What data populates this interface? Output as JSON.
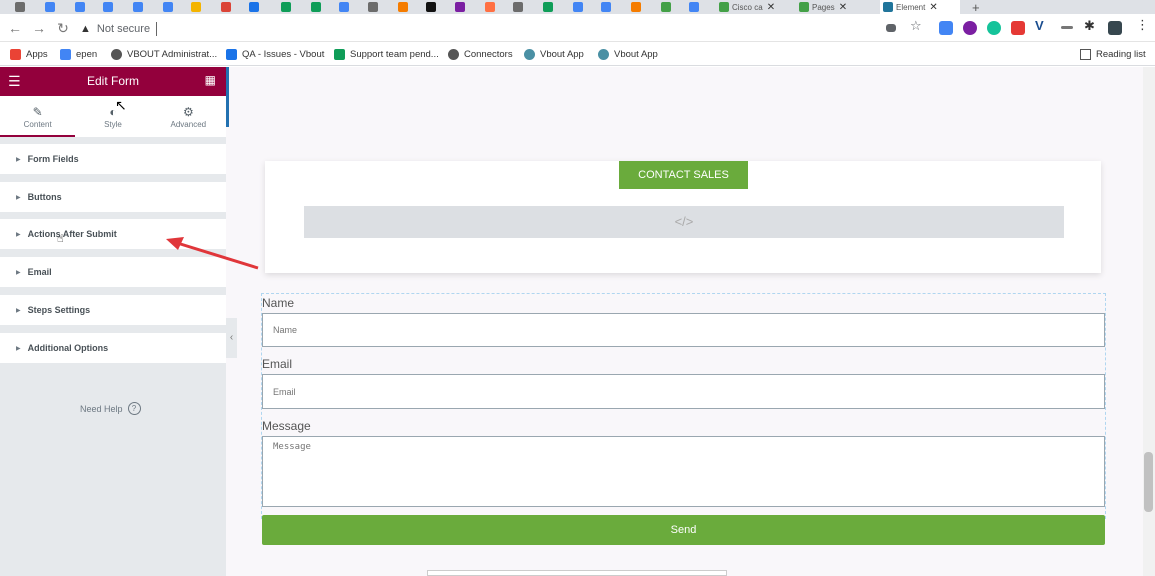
{
  "browser": {
    "tabs": [
      {
        "label": "",
        "color": "#6c6c6c"
      },
      {
        "label": "",
        "color": "#4285f4"
      },
      {
        "label": "",
        "color": "#4285f4"
      },
      {
        "label": "",
        "color": "#4285f4"
      },
      {
        "label": "",
        "color": "#4285f4"
      },
      {
        "label": "",
        "color": "#4285f4"
      },
      {
        "label": "",
        "color": "#f4b400"
      },
      {
        "label": "",
        "color": "#db4437"
      },
      {
        "label": "",
        "color": "#1a73e8"
      },
      {
        "label": "",
        "color": "#0f9d58"
      },
      {
        "label": "",
        "color": "#0f9d58"
      },
      {
        "label": "",
        "color": "#4285f4"
      },
      {
        "label": "",
        "color": "#6c6c6c"
      },
      {
        "label": "",
        "color": "#f57c00"
      },
      {
        "label": "",
        "color": "#111111"
      },
      {
        "label": "",
        "color": "#7b1fa2"
      },
      {
        "label": "",
        "color": "#ff7043"
      },
      {
        "label": "",
        "color": "#6c6c6c"
      },
      {
        "label": "",
        "color": "#0f9d58"
      },
      {
        "label": "",
        "color": "#4285f4"
      },
      {
        "label": "",
        "color": "#4285f4"
      },
      {
        "label": "",
        "color": "#f57c00"
      },
      {
        "label": "",
        "color": "#43a047"
      },
      {
        "label": "",
        "color": "#4285f4"
      },
      {
        "label": "Cisco ca",
        "color": "#43a047"
      },
      {
        "label": "Pages",
        "color": "#43a047"
      },
      {
        "label": "Element",
        "color": "#21759b",
        "active": true
      }
    ],
    "new_tab": "+",
    "address_warning": "Not secure",
    "bookmarks": [
      {
        "label": "Apps",
        "icon": "apps-grid-icon",
        "color": "#ea4335"
      },
      {
        "label": "epen",
        "icon": "page-icon",
        "color": "#4285f4"
      },
      {
        "label": "VBOUT Administrat...",
        "icon": "globe-icon",
        "color": "#555555"
      },
      {
        "label": "QA - Issues - Vbout",
        "icon": "diamond-icon",
        "color": "#1a73e8"
      },
      {
        "label": "Support team pend...",
        "icon": "sheet-icon",
        "color": "#0f9d58"
      },
      {
        "label": "Connectors",
        "icon": "globe-icon",
        "color": "#555555"
      },
      {
        "label": "Vbout App",
        "icon": "circle-icon",
        "color": "#4a90a4"
      },
      {
        "label": "Vbout App",
        "icon": "circle-icon",
        "color": "#4a90a4"
      }
    ],
    "reading_list": "Reading list"
  },
  "panel": {
    "header_title": "Edit Form",
    "tabs": [
      {
        "label": "Content",
        "icon": "pencil-icon"
      },
      {
        "label": "Style",
        "icon": "contrast-icon"
      },
      {
        "label": "Advanced",
        "icon": "gear-icon"
      }
    ],
    "sections": [
      "Form Fields",
      "Buttons",
      "Actions After Submit",
      "Email",
      "Steps Settings",
      "Additional Options"
    ],
    "need_help": "Need Help"
  },
  "preview": {
    "contact_button": "CONTACT SALES",
    "code_icon": "</>",
    "form": {
      "name_label": "Name",
      "name_placeholder": "Name",
      "email_label": "Email",
      "email_placeholder": "Email",
      "message_label": "Message",
      "message_placeholder": "Message",
      "send_label": "Send"
    }
  },
  "colors": {
    "panel_header": "#93003c",
    "accent_green": "#6aab3c",
    "annotation_arrow": "#e0363a"
  }
}
